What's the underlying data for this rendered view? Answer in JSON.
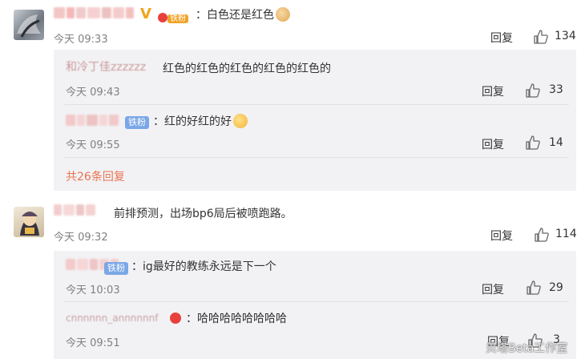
{
  "comments": [
    {
      "text": "：白色还是红色",
      "time": "今天 09:33",
      "reply_label": "回复",
      "likes": "134",
      "fan_badge": "铁粉",
      "replies": [
        {
          "name": "和冷丁佳zzzzzz",
          "text": "红色的红色的红色的红色的红色的",
          "time": "今天 09:43",
          "reply_label": "回复",
          "likes": "33"
        },
        {
          "badge": "铁粉",
          "text": "：红的好红的好",
          "time": "今天 09:55",
          "reply_label": "回复",
          "likes": "14"
        }
      ],
      "more_label": "共26条回复"
    },
    {
      "text": "前排预测，出场bp6局后被喷跑路。",
      "time": "今天 09:32",
      "reply_label": "回复",
      "likes": "114",
      "replies": [
        {
          "badge": "铁粉",
          "text": "：ig最好的教练永远是下一个",
          "time": "今天 10:03",
          "reply_label": "回复",
          "likes": "29"
        },
        {
          "name": "cnnnnnn_annnnnnf",
          "text": "：哈哈哈哈哈哈哈哈",
          "time": "今天 09:51",
          "reply_label": "回复",
          "likes": "3"
        }
      ]
    }
  ],
  "watermark": "贝塔Beta工作室",
  "colors": {
    "panel": "#f2f2f5",
    "more": "#eb7350",
    "badge": "#7aa7e6",
    "vip": "#f1a31b"
  }
}
